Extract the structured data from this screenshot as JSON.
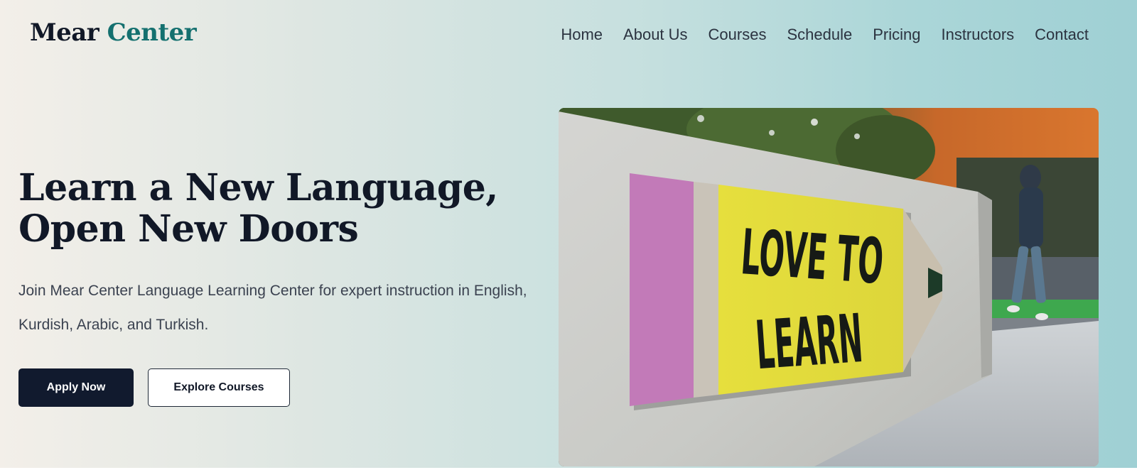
{
  "brand": {
    "part1": "Mear",
    "part2": "Center"
  },
  "nav": {
    "items": [
      {
        "label": "Home"
      },
      {
        "label": "About Us"
      },
      {
        "label": "Courses"
      },
      {
        "label": "Schedule"
      },
      {
        "label": "Pricing"
      },
      {
        "label": "Instructors"
      },
      {
        "label": "Contact"
      }
    ]
  },
  "hero": {
    "title_line1": "Learn a New Language,",
    "title_line2": "Open New Doors",
    "subtitle": "Join Mear Center Language Learning Center for expert instruction in English, Kurdish, Arabic, and Turkish.",
    "primary_button": "Apply Now",
    "secondary_button": "Explore Courses",
    "image": {
      "sign_line1": "LOVE TO",
      "sign_line2": "LEARN"
    }
  },
  "colors": {
    "brand_accent": "#14706f",
    "primary_dark": "#111a2e"
  }
}
